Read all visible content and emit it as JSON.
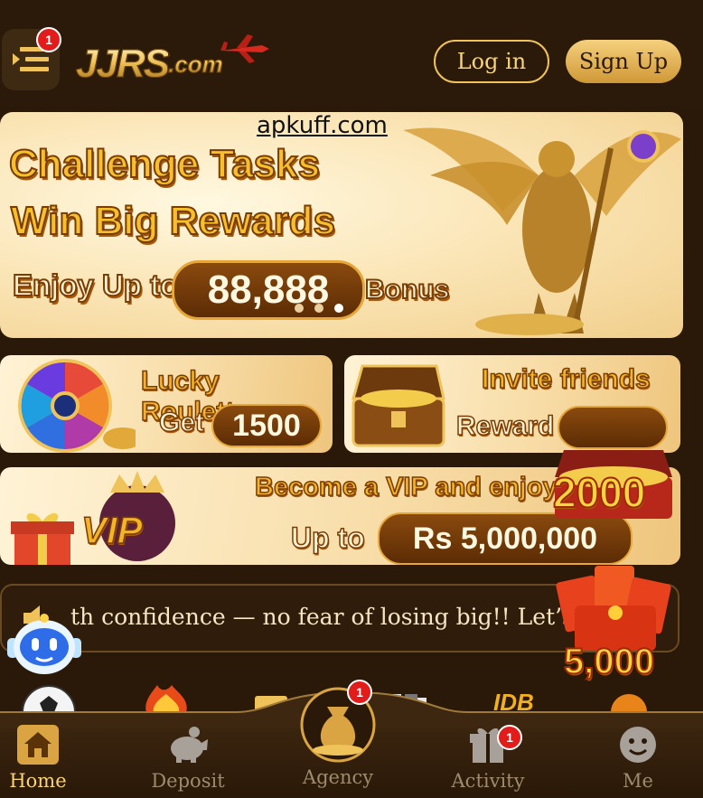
{
  "header": {
    "menu_badge": "1",
    "logo_main": "JJRS",
    "logo_suffix": ".com",
    "login_label": "Log in",
    "signup_label": "Sign Up"
  },
  "watermark": "apkuff.com",
  "hero": {
    "line1": "Challenge Tasks",
    "line2": "Win Big Rewards",
    "enjoy": "Enjoy Up to",
    "amount": "88,888",
    "bonus": "Bonus",
    "slide_count": 3,
    "active_slide": 3
  },
  "promos": {
    "roulette": {
      "title": "Lucky Roulette",
      "get": "Get",
      "amount": "1500"
    },
    "invite": {
      "title": "Invite friends",
      "reward": "Reward",
      "amount": "2000"
    },
    "vip": {
      "badge": "VIP",
      "title": "Become a VIP and enjoy",
      "upto": "Up to",
      "amount": "Rs 5,000,000"
    }
  },
  "floating_offer": {
    "amount": "5,000"
  },
  "marquee": {
    "text": "th confidence — no fear of losing big!! Let’s g"
  },
  "agency_badge": "1",
  "activity_badge": "1",
  "nav": {
    "home": "Home",
    "deposit": "Deposit",
    "agency": "Agency",
    "activity": "Activity",
    "me": "Me"
  },
  "colors": {
    "background": "#2a1808",
    "gold": "#f0c35a",
    "badge_red": "#e21b1b"
  }
}
